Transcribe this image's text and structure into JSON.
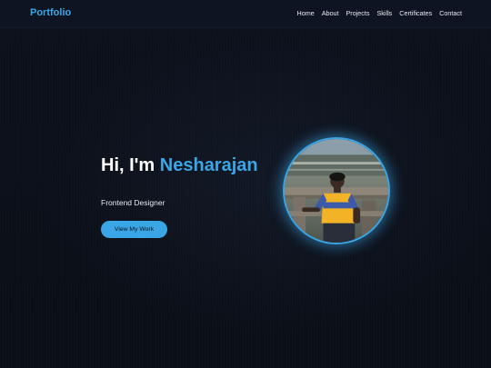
{
  "navbar": {
    "logo": "Portfolio",
    "links": [
      "Home",
      "About",
      "Projects",
      "Skills",
      "Certificates",
      "Contact"
    ]
  },
  "hero": {
    "greeting": "Hi, I'm",
    "name": "Nesharajan",
    "subtitle": "Frontend Designer",
    "cta_label": "View My Work"
  },
  "colors": {
    "accent": "#3aa6e6",
    "background": "#0b0f18",
    "navbar": "#0e1422"
  },
  "icons": {
    "avatar": "profile-photo"
  }
}
